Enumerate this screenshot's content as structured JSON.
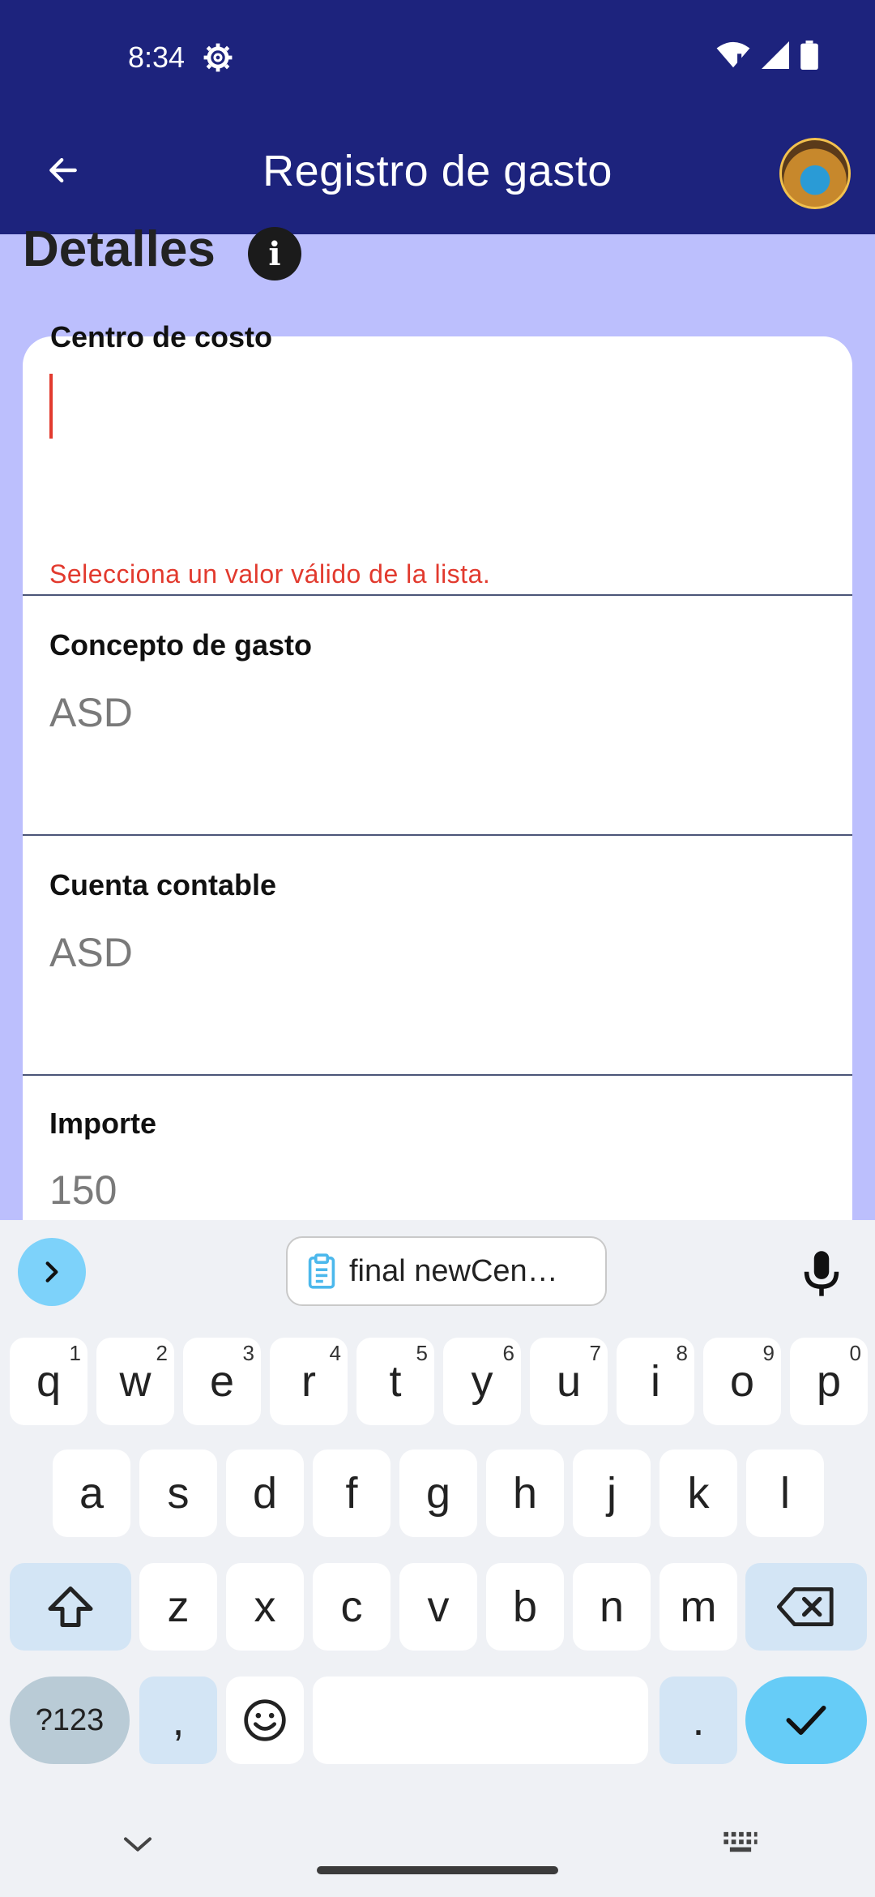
{
  "status_bar": {
    "time": "8:34"
  },
  "app_bar": {
    "title": "Registro de gasto"
  },
  "section": {
    "heading": "Detalles"
  },
  "fields": [
    {
      "label": "Centro de costo",
      "value": "",
      "error": "Selecciona un valor válido de la lista."
    },
    {
      "label": "Concepto de gasto",
      "value": "ASD"
    },
    {
      "label": "Cuenta contable",
      "value": "ASD"
    },
    {
      "label": "Importe",
      "value": "150"
    }
  ],
  "keyboard": {
    "clipboard_suggestion": "final newCen…",
    "row1": [
      {
        "k": "q",
        "s": "1"
      },
      {
        "k": "w",
        "s": "2"
      },
      {
        "k": "e",
        "s": "3"
      },
      {
        "k": "r",
        "s": "4"
      },
      {
        "k": "t",
        "s": "5"
      },
      {
        "k": "y",
        "s": "6"
      },
      {
        "k": "u",
        "s": "7"
      },
      {
        "k": "i",
        "s": "8"
      },
      {
        "k": "o",
        "s": "9"
      },
      {
        "k": "p",
        "s": "0"
      }
    ],
    "row2": [
      "a",
      "s",
      "d",
      "f",
      "g",
      "h",
      "j",
      "k",
      "l"
    ],
    "row3": [
      "z",
      "x",
      "c",
      "v",
      "b",
      "n",
      "m"
    ],
    "symbols_key": "?123",
    "comma_key": ",",
    "period_key": "."
  },
  "colors": {
    "app_bar": "#1d237d",
    "background": "#bcbffd",
    "error": "#e23a2e",
    "accent": "#66ccf7"
  }
}
